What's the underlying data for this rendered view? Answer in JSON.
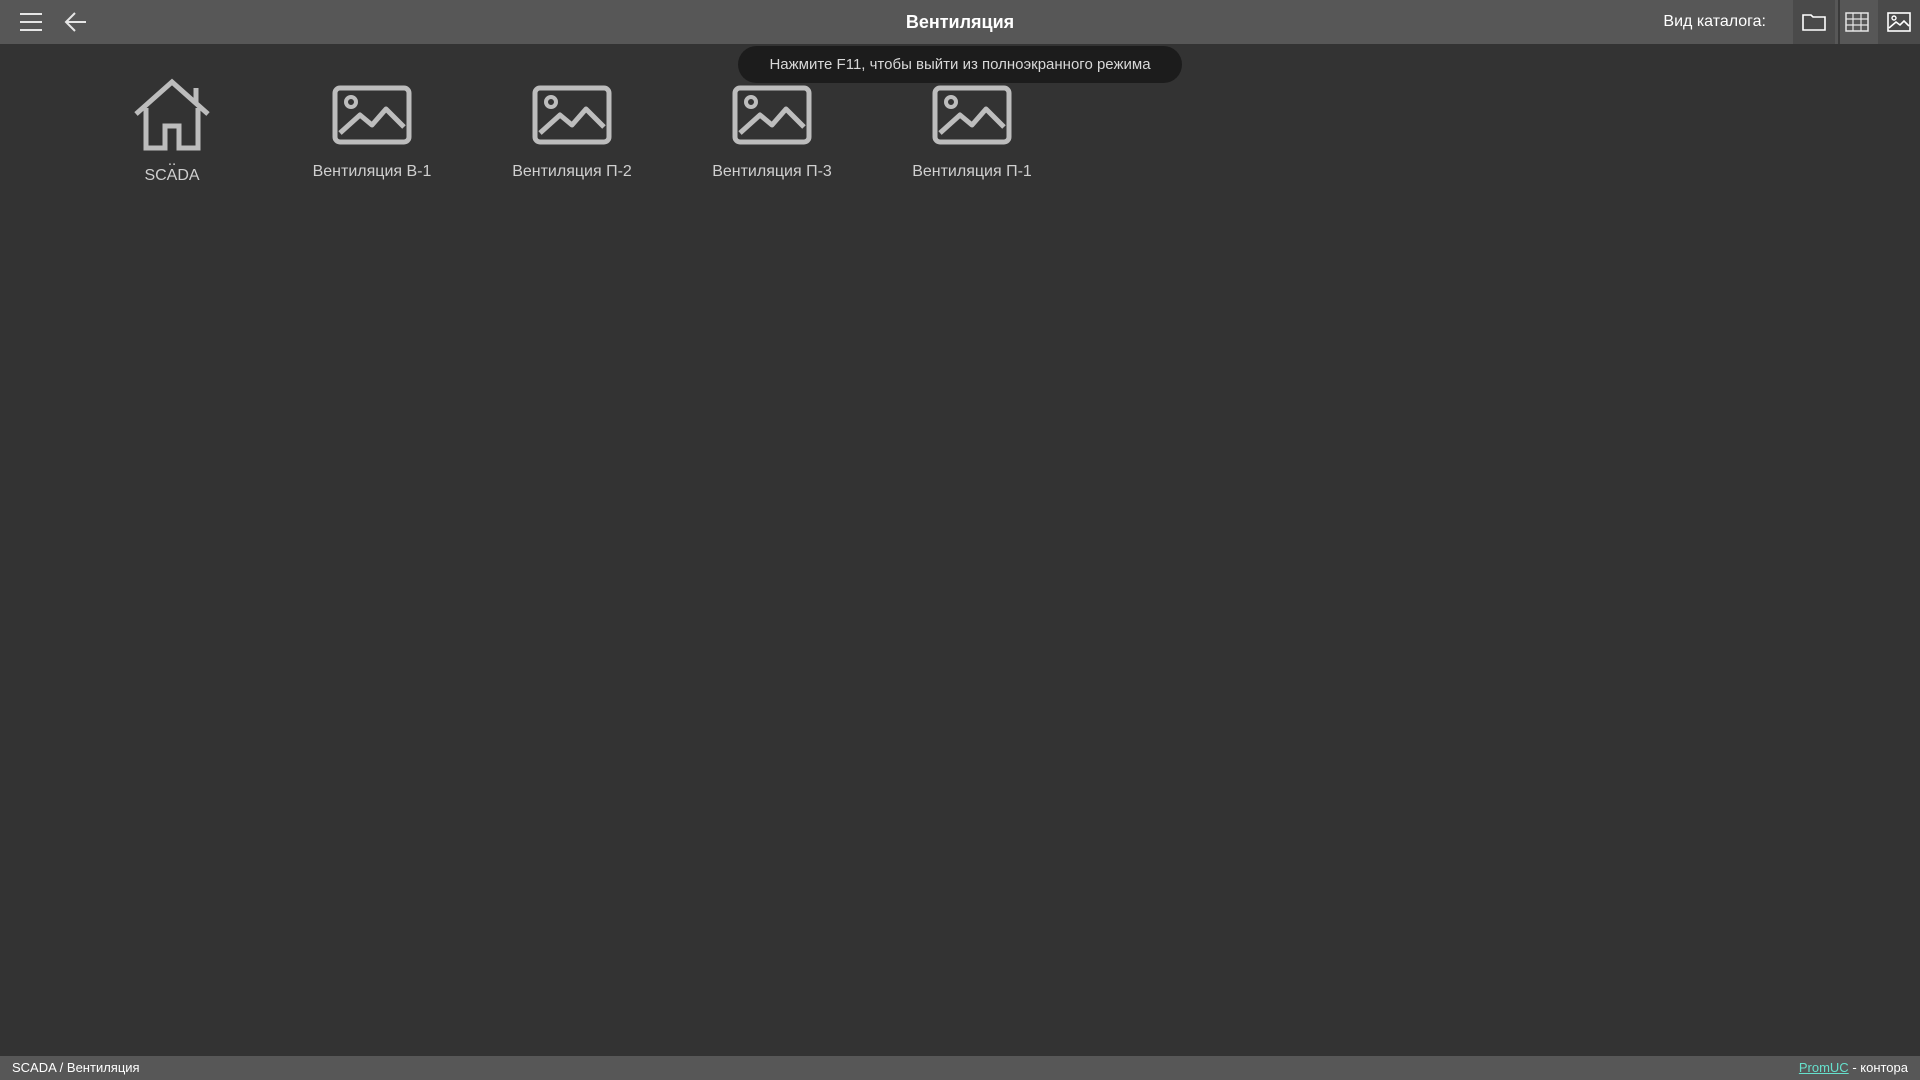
{
  "header": {
    "title": "Вентиляция",
    "view_label": "Вид каталога:",
    "icons": {
      "menu": "hamburger-menu-icon",
      "back": "arrow-left-icon",
      "view_folder": "folder-icon",
      "view_table": "table-grid-icon",
      "view_image": "image-icon"
    }
  },
  "toast": {
    "text": "Нажмите F11, чтобы выйти из полноэкранного режима"
  },
  "items": [
    {
      "dots": "..",
      "label": "SCADA",
      "icon": "home-icon"
    },
    {
      "label": "Вентиляция В-1",
      "icon": "image-icon"
    },
    {
      "label": "Вентиляция П-2",
      "icon": "image-icon"
    },
    {
      "label": "Вентиляция П-3",
      "icon": "image-icon"
    },
    {
      "label": "Вентиляция П-1",
      "icon": "image-icon"
    }
  ],
  "footer": {
    "breadcrumb": "SCADA / Вентиляция",
    "brand_link": "PromUC",
    "brand_suffix": " - контора"
  },
  "colors": {
    "header_bg": "#575757",
    "page_bg": "#333333",
    "toast_bg": "#1c1c1c",
    "icon": "#bdbdbd",
    "link": "#66e0cc"
  }
}
